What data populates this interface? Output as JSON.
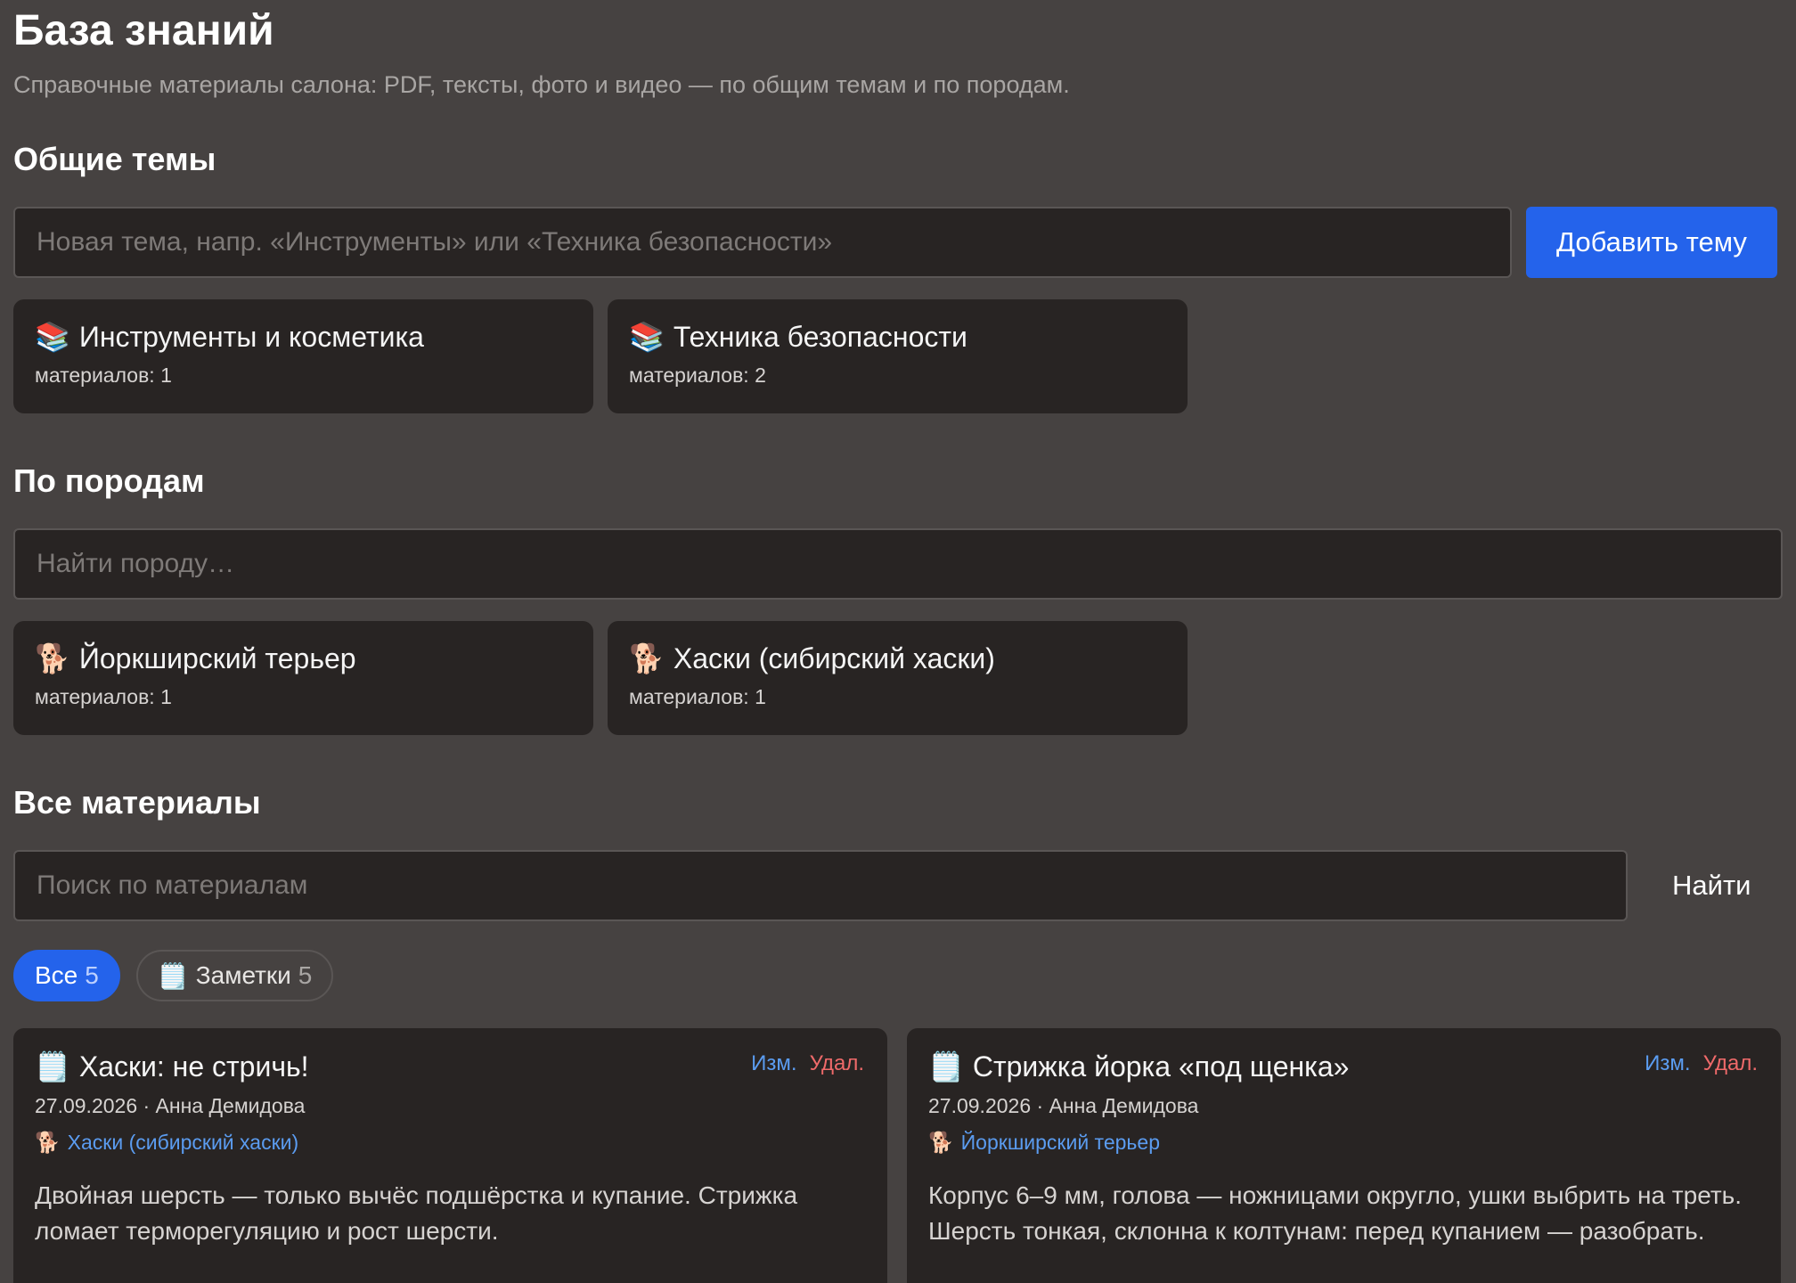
{
  "page": {
    "title": "База знаний",
    "subtitle": "Справочные материалы салона: PDF, тексты, фото и видео — по общим темам и по породам."
  },
  "topics": {
    "heading": "Общие темы",
    "input_placeholder": "Новая тема, напр. «Инструменты» или «Техника безопасности»",
    "add_label": "Добавить тему",
    "items": [
      {
        "icon": "📚",
        "title": "Инструменты и косметика",
        "meta": "материалов: 1"
      },
      {
        "icon": "📚",
        "title": "Техника безопасности",
        "meta": "материалов: 2"
      }
    ]
  },
  "breeds": {
    "heading": "По породам",
    "search_placeholder": "Найти породу…",
    "items": [
      {
        "icon": "🐕",
        "title": "Йоркширский терьер",
        "meta": "материалов: 1"
      },
      {
        "icon": "🐕",
        "title": "Хаски (сибирский хаски)",
        "meta": "материалов: 1"
      }
    ]
  },
  "materials": {
    "heading": "Все материалы",
    "search_placeholder": "Поиск по материалам",
    "search_label": "Найти",
    "filters": [
      {
        "icon": "",
        "label": "Все",
        "count": "5"
      },
      {
        "icon": "🗒️",
        "label": "Заметки",
        "count": "5"
      }
    ],
    "edit_label": "Изм.",
    "delete_label": "Удал.",
    "items": [
      {
        "icon": "🗒️",
        "title": "Хаски: не стричь!",
        "meta": "27.09.2026 · Анна Демидова",
        "tag_icon": "🐕",
        "tag": "Хаски (сибирский хаски)",
        "body": "Двойная шерсть — только вычёс подшёрстка и купание. Стрижка ломает терморегуляцию и рост шерсти."
      },
      {
        "icon": "🗒️",
        "title": "Стрижка йорка «под щенка»",
        "meta": "27.09.2026 · Анна Демидова",
        "tag_icon": "🐕",
        "tag": "Йоркширский терьер",
        "body": "Корпус 6–9 мм, голова — ножницами округло, ушки выбрить на треть. Шерсть тонкая, склонна к колтунам: перед купанием — разобрать."
      }
    ]
  }
}
